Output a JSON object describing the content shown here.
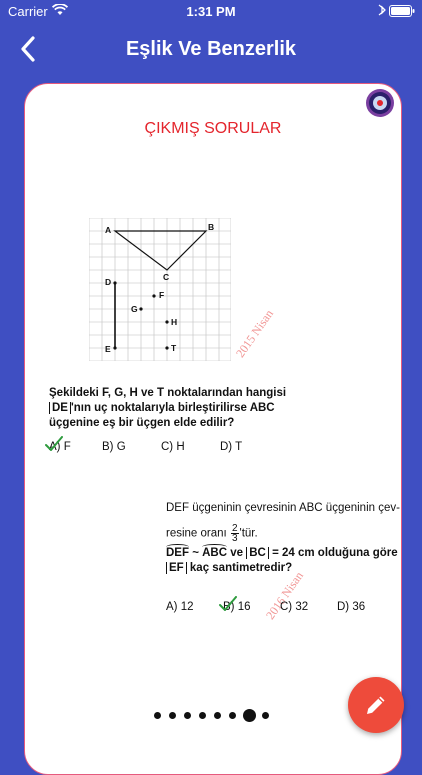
{
  "status": {
    "carrier": "Carrier",
    "time": "1:31 PM"
  },
  "nav": {
    "title": "Eşlik Ve Benzerlik"
  },
  "card": {
    "section_title": "ÇIKMIŞ SORULAR"
  },
  "figure1": {
    "labels": {
      "A": "A",
      "B": "B",
      "C": "C",
      "D": "D",
      "E": "E",
      "F": "F",
      "G": "G",
      "H": "H",
      "T": "T"
    }
  },
  "question1": {
    "line1": "Şekildeki F, G, H ve T noktalarından hangisi",
    "segment": "DE",
    "line2_rest": "'nın uç noktalarıyla birleştirilirse ABC",
    "line3": "üçgenine eş bir üçgen elde edilir?",
    "stamp": "2015 Nisan",
    "options": [
      "A) F",
      "B) G",
      "C) H",
      "D) T"
    ]
  },
  "question2": {
    "line1": "DEF üçgeninin çevresinin ABC üçgeninin çev-",
    "line2_pre": "resine oranı",
    "frac_num": "2",
    "frac_den": "3",
    "line2_post": "'tür.",
    "tri1": "DEF",
    "sim": "~",
    "tri2": "ABC",
    "line3_mid": "ve",
    "bc": "BC",
    "line3_post": "= 24 cm olduğuna göre",
    "ef": "EF",
    "line4_post": "kaç santimetredir?",
    "stamp": "2016 Nisan",
    "options": [
      "A) 12",
      "B) 16",
      "C) 32",
      "D) 36"
    ]
  },
  "pager": {
    "count": 8,
    "active_index": 7
  },
  "colors": {
    "background": "#3F4FC2",
    "title_red": "#E4252D",
    "fab": "#EE4B3B",
    "check_green": "#2E9B3E",
    "stamp": "#F19594"
  }
}
